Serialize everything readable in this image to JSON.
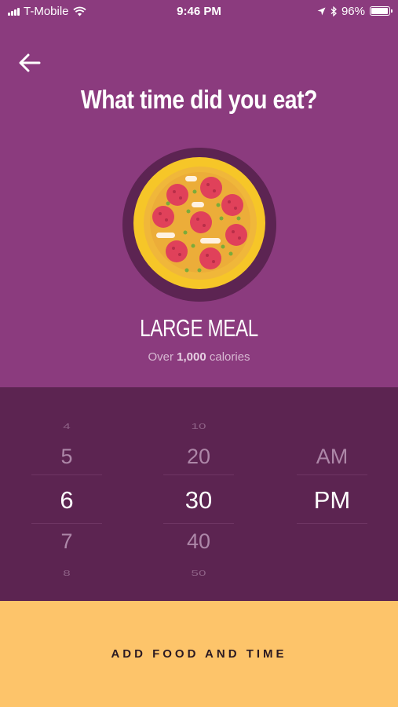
{
  "status_bar": {
    "carrier": "T-Mobile",
    "time": "9:46 PM",
    "battery": "96%",
    "battery_level": 0.96
  },
  "header": {
    "title": "What time did you eat?"
  },
  "meal": {
    "name": "LARGE MEAL",
    "subtitle_prefix": "Over ",
    "subtitle_value": "1,000",
    "subtitle_suffix": " calories"
  },
  "picker": {
    "hours": [
      "4",
      "5",
      "6",
      "7",
      "8"
    ],
    "minutes": [
      "10",
      "20",
      "30",
      "40",
      "50"
    ],
    "ampm": [
      "AM",
      "PM"
    ],
    "selected_hour": "6",
    "selected_minute": "30",
    "selected_ampm": "PM"
  },
  "cta": {
    "label": "ADD FOOD AND TIME"
  },
  "icons": {
    "back": "arrow-left-icon",
    "wifi": "wifi-icon",
    "location": "location-arrow-icon",
    "bluetooth": "bluetooth-icon"
  }
}
